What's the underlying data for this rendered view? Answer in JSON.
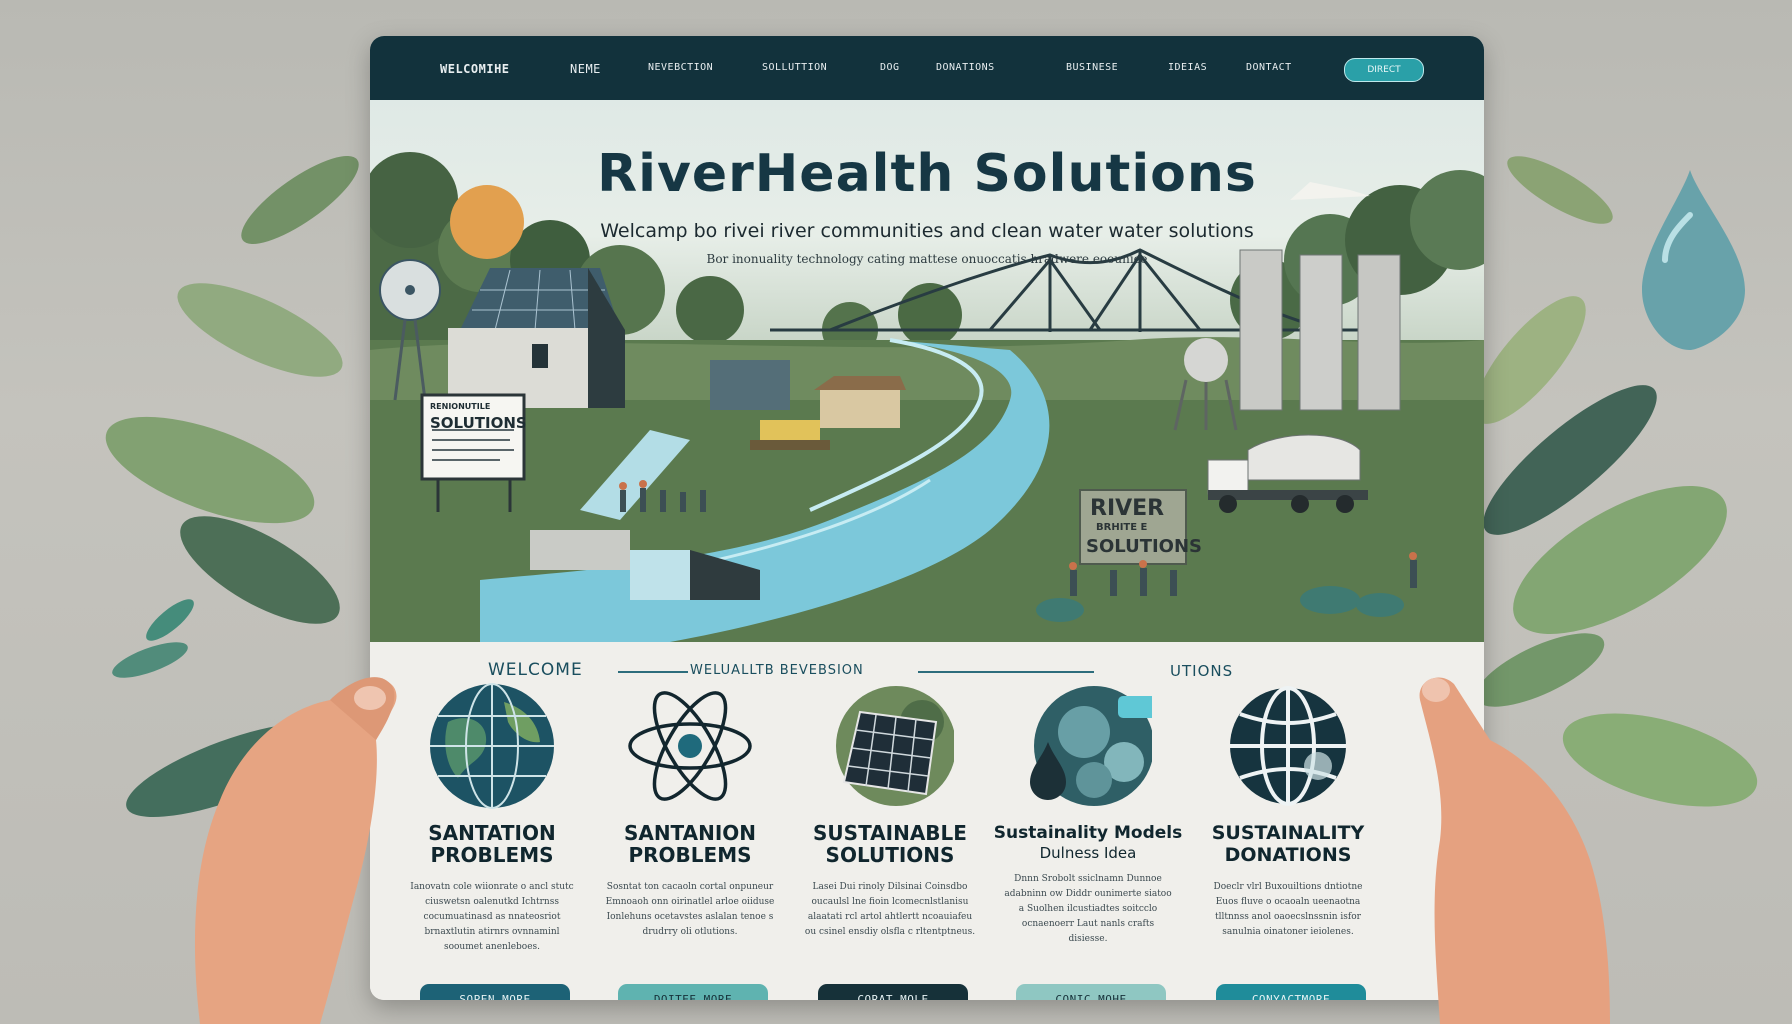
{
  "nav": {
    "items": [
      "WELCOMIHE",
      "NEME",
      "NEVEBCTION",
      "SOLLUTTION",
      "DOG",
      "DONATIONS",
      "BUSINESE",
      "IDEIAS",
      "DONTACT"
    ],
    "button": "DIRECT"
  },
  "hero": {
    "title": "RiverHealth Solutions",
    "subtitle": "Welcamp bo rivei river communities and clean water water solutions",
    "tagline": "Bor inonuality technology cating mattese onuoccatis hradwere eoounice",
    "sign_left": "SOLUTIONS",
    "sign_left_top": "RENIONUTILE",
    "sign_right_top": "RIVER",
    "sign_right_mid": "BRHITE E",
    "sign_right_bottom": "SOLUTIONS"
  },
  "section": {
    "welcome_label": "WELCOME",
    "middle_label": "WELUALLTB BEVEBSION",
    "right_label": "UTIONS"
  },
  "features": [
    {
      "icon": "globe-icon",
      "title": "SANTATION PROBLEMS",
      "desc": "Ianovatn cole wiionrate o ancl stutc ciuswetsn oalenutkd Ichtrnss cocumuatinasd as nnateosriot brnaxtlutin atirnrs ovnnaminl sooumet anenleboes.",
      "cta": "SOPEN MORE",
      "cta_color": "#1d6276"
    },
    {
      "icon": "atom-icon",
      "title": "SANTANION PROBLEMS",
      "desc": "Sosntat ton cacaoln cortal onpuneur Emnoaoh onn oirinatlel arloe oiiduse Ionlehuns ocetavstes aslalan tenoe s drudrry oli otlutions.",
      "cta": "DOITEE MORE",
      "cta_color": "#5fb3b0"
    },
    {
      "icon": "solar-panel-icon",
      "title": "SUSTAINABLE SOLUTIONS",
      "desc": "Lasei Dui rinoly Dilsinai Coinsdbo oucaulsl lne fioin lcomecnlstlanisu alaatati rcl artol ahtlertt ncoauiafeu ou csinel ensdiy olsfla c rltentptneus.",
      "cta": "CORAT MOLE",
      "cta_color": "#163139"
    },
    {
      "icon": "water-drop-icon",
      "title": "Sustainality Models",
      "subtitle": "Dulness Idea",
      "desc": "Dnnn Srobolt ssiclnamn Dunnoe adabninn ow Diddr ounimerte siatoo a Suolhen ilcustiadtes soitcclo ocnaenoerr Laut nanls crafts disiesse.",
      "cta": "CONIC MOHE",
      "cta_color": "#8fc7c2"
    },
    {
      "icon": "globe-wire-icon",
      "title": "SUSTAINALITY DONATIONS",
      "desc": "Doeclr vlrl Buxouiltions dntiotne Euos fluve o ocaoaln ueenaotna tlltnnss anol oaoecslnssnin isfor sanulnia oinatoner ieiolenes.",
      "cta": "CONYACTMORE",
      "cta_color": "#1f8c9a"
    }
  ],
  "colors": {
    "nav_bg": "#12323c",
    "title": "#163744",
    "river": "#7cc8da",
    "accent": "#2aa0a8"
  }
}
